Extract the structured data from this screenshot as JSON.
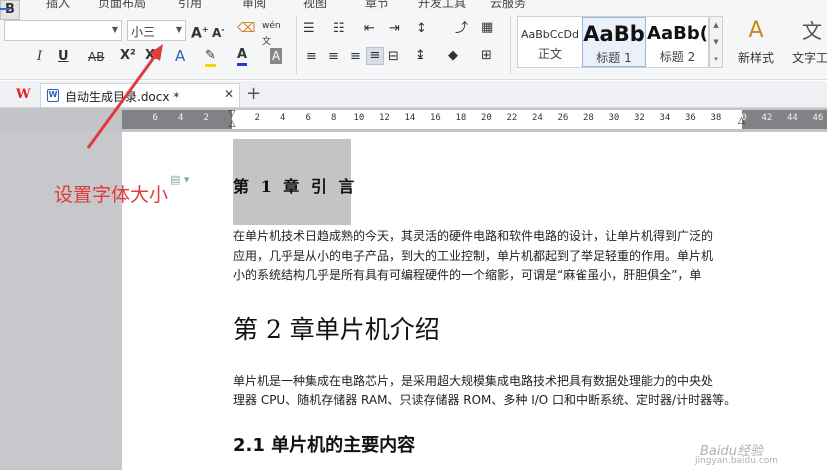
{
  "ribbon": {
    "tabs": [
      "插入",
      "页面布局",
      "引用",
      "审阅",
      "视图",
      "章节",
      "开发工具",
      "云服务"
    ],
    "font_name": "",
    "font_size": "小三",
    "style_gallery": [
      {
        "sample": "AaBbCcDd",
        "name": "正文"
      },
      {
        "sample": "AaBb",
        "name": "标题 1"
      },
      {
        "sample": "AaBb(",
        "name": "标题 2"
      }
    ],
    "new_style_label": "新样式",
    "text_tool_label": "文字工",
    "accent_color": "#1e6fd9"
  },
  "document_tab": {
    "app_logo": "W",
    "title": "自动生成目录.docx *"
  },
  "ruler": {
    "labels_left": [
      "6",
      "4",
      "2"
    ],
    "labels_right": [
      "2",
      "4",
      "6",
      "8",
      "10",
      "12",
      "14",
      "16",
      "18",
      "20",
      "22",
      "24",
      "26",
      "28",
      "30",
      "32",
      "34",
      "36",
      "38",
      "40",
      "42",
      "44",
      "46"
    ]
  },
  "document": {
    "chapter1_heading": "第 1 章  引  言",
    "para1": [
      "在单片机技术日趋成熟的今天，其灵活的硬件电路和软件电路的设计，让单片机得到广泛的",
      "应用，几乎是从小的电子产品，到大的工业控制，单片机都起到了举足轻重的作用。单片机",
      "小的系统结构几乎是所有具有可编程硬件的一个缩影，可谓是“麻雀虽小，肝胆俱全”，单"
    ],
    "chapter2_heading": "第 2 章单片机介绍",
    "para2": [
      "单片机是一种集成在电路芯片，是采用超大规模集成电路技术把具有数据处理能力的中央处",
      "理器 CPU、随机存储器 RAM、只读存储器 ROM、多种 I/O 口和中断系统、定时器/计时器等。"
    ],
    "section_heading": "2.1 单片机的主要内容"
  },
  "annotation": {
    "text": "设置字体大小",
    "color": "#e23a3a"
  },
  "watermark": {
    "line1": "Baidu经验",
    "line2": "jingyan.baidu.com"
  }
}
